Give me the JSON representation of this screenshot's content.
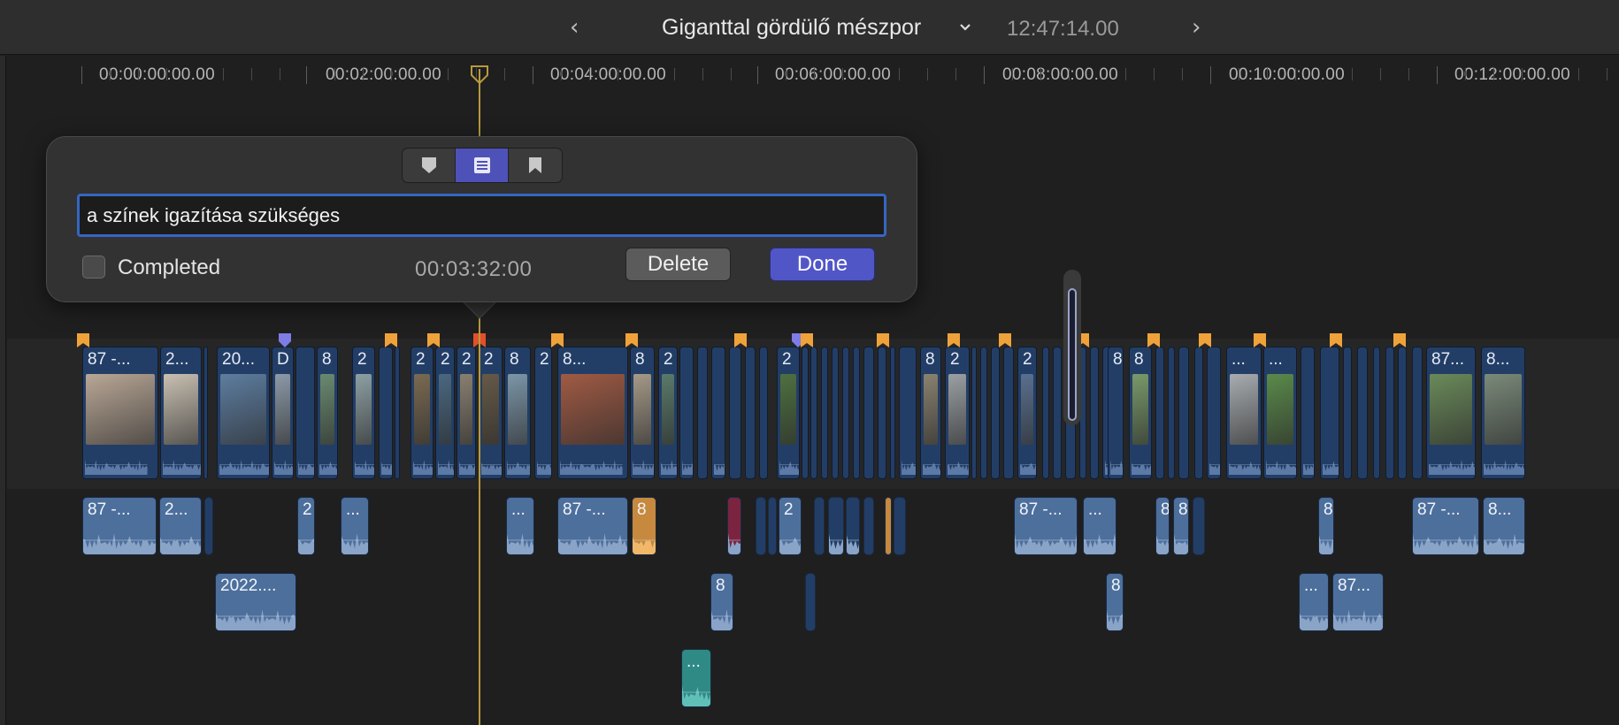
{
  "title_bar": {
    "back_icon": "chevron-left-icon",
    "project_name": "Giganttal gördülő mészpor",
    "project_menu_icon": "chevron-down-icon",
    "duration": "12:47:14.00",
    "forward_icon": "chevron-right-icon"
  },
  "ruler": {
    "labels": [
      "00:00:00:00.00",
      "00:02:00:00.00",
      "00:04:00:00.00",
      "00:06:00:00.00",
      "00:08:00:00.00",
      "00:10:00:00.00",
      "00:12:00:00.00"
    ]
  },
  "popover": {
    "tabs": [
      {
        "name": "standard-marker",
        "icon": "marker-icon",
        "active": false
      },
      {
        "name": "todo-marker",
        "icon": "list-icon",
        "active": true
      },
      {
        "name": "chapter-marker",
        "icon": "bookmark-icon",
        "active": false
      }
    ],
    "marker_name_value": "a színek igazítása szükséges",
    "completed_label": "Completed",
    "completed_checked": false,
    "timecode": "00:03:32:00",
    "delete_label": "Delete",
    "done_label": "Done",
    "accent_color": "#5156c7"
  },
  "timeline": {
    "primary_clips": [
      {
        "label": "87 -..."
      },
      {
        "label": "2..."
      },
      {
        "label": "20..."
      },
      {
        "label": "D"
      },
      {
        "label": "8"
      },
      {
        "label": "2"
      },
      {
        "label": "2"
      },
      {
        "label": "2"
      },
      {
        "label": "2"
      },
      {
        "label": "2"
      },
      {
        "label": "8"
      },
      {
        "label": "2"
      },
      {
        "label": "8..."
      },
      {
        "label": "8"
      },
      {
        "label": "2"
      },
      {
        "label": "2"
      },
      {
        "label": "8"
      },
      {
        "label": "2"
      },
      {
        "label": "2"
      },
      {
        "label": "8"
      },
      {
        "label": "8"
      },
      {
        "label": "..."
      },
      {
        "label": "..."
      },
      {
        "label": "87..."
      },
      {
        "label": "8..."
      }
    ],
    "connected_audio_row1": [
      {
        "label": "87 -..."
      },
      {
        "label": "2..."
      },
      {
        "label": "2"
      },
      {
        "label": "..."
      },
      {
        "label": "..."
      },
      {
        "label": "87 -..."
      },
      {
        "label": "8"
      },
      {
        "label": "2"
      },
      {
        "label": "87 -..."
      },
      {
        "label": "..."
      },
      {
        "label": "8"
      },
      {
        "label": "8"
      },
      {
        "label": "8"
      },
      {
        "label": "87 -..."
      },
      {
        "label": "8..."
      }
    ],
    "connected_audio_row2": [
      {
        "label": "2022...."
      },
      {
        "label": "8"
      },
      {
        "label": "8"
      },
      {
        "label": "..."
      },
      {
        "label": "87..."
      }
    ],
    "connected_audio_row3": [
      {
        "label": "..."
      }
    ],
    "colors": {
      "video_clip": "#233e66",
      "audio_clip": "#4d6f9c",
      "todo_marker": "#f0a23a",
      "standard_marker": "#7e7ce6",
      "selected_marker": "#e2502a",
      "playhead": "#b89a3d"
    }
  }
}
